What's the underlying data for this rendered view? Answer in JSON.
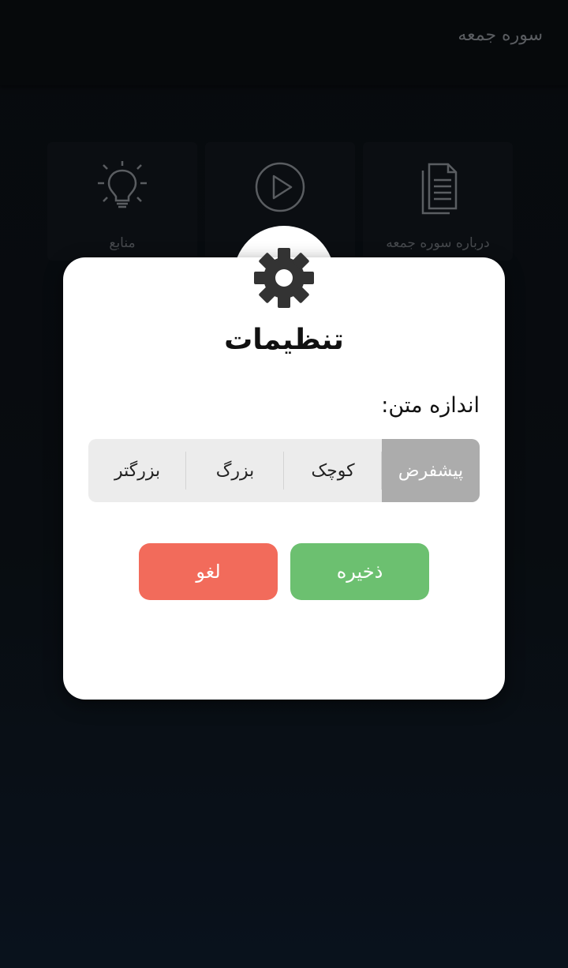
{
  "app_bar": {
    "title": "سوره جمعه"
  },
  "menu": {
    "items": [
      {
        "label": "درباره سوره جمعه",
        "icon": "document-icon"
      },
      {
        "label": "",
        "icon": "play-icon"
      },
      {
        "label": "منابع",
        "icon": "lightbulb-icon"
      }
    ]
  },
  "dialog": {
    "title": "تنظیمات",
    "icon": "gear-icon",
    "text_size_label": "اندازه متن:",
    "text_size_options": [
      "پیشفرض",
      "کوچک",
      "بزرگ",
      "بزرگتر"
    ],
    "selected_option": "پیشفرض",
    "save_label": "ذخیره",
    "cancel_label": "لغو"
  },
  "colors": {
    "save": "#6cc070",
    "cancel": "#f26b5b",
    "selected_segment": "#acacac"
  }
}
